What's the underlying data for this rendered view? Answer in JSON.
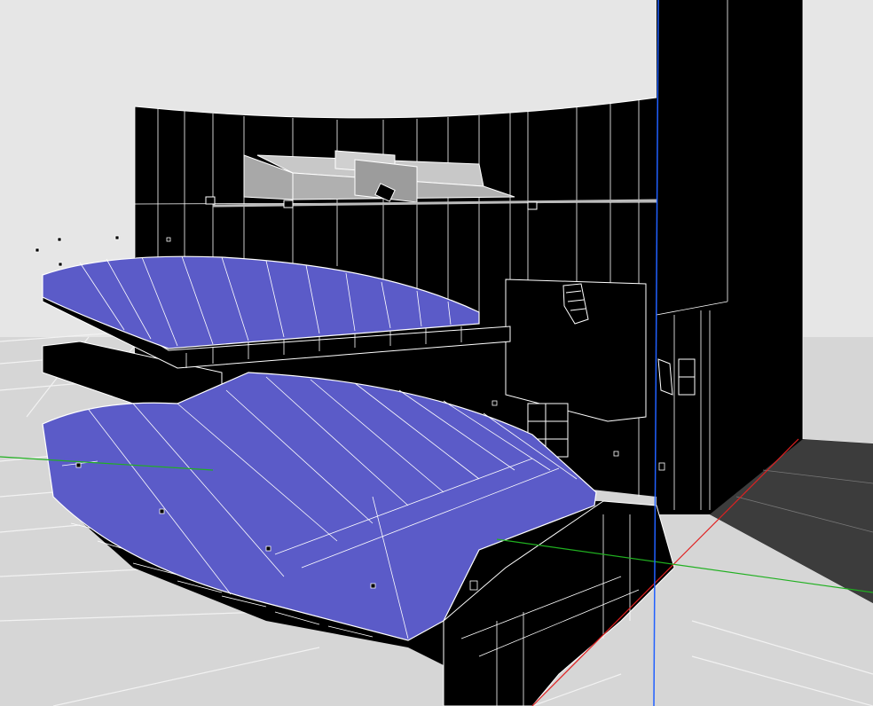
{
  "viewport": {
    "view": "perspective",
    "render_mode": "wireframe-shaded"
  },
  "colors": {
    "background": "#d6d6d6",
    "upper_background": "#e6e6e6",
    "floor_plane": "#cfcfcf",
    "grid_lines": "#f2f2f2",
    "walls": "#000000",
    "wire_edges": "#ffffff",
    "seating_tiers": "#5b5bc8",
    "glass_ceiling": "#b8b8b8",
    "stage_floor": "#3c3c3c",
    "axis_x": "#e02020",
    "axis_y": "#20b020",
    "axis_z": "#2060ff"
  },
  "objects": [
    {
      "name": "upper-balcony-tier",
      "material": "seating"
    },
    {
      "name": "lower-orchestra-tier",
      "material": "seating"
    },
    {
      "name": "rear-curved-wall",
      "material": "wall"
    },
    {
      "name": "acoustic-ceiling-panels",
      "material": "glass"
    },
    {
      "name": "speaker-cluster",
      "material": "equipment"
    },
    {
      "name": "stage-tower",
      "material": "wall"
    },
    {
      "name": "stage-floor",
      "material": "floor"
    }
  ]
}
